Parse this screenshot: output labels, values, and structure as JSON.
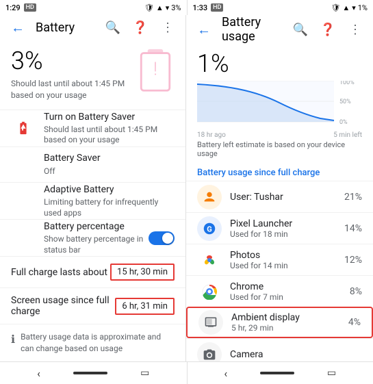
{
  "left": {
    "statusBar": {
      "time": "1:29",
      "indicator": "HD",
      "batteryPct": "3%",
      "icons": [
        "shield",
        "signal",
        "wifi",
        "battery"
      ]
    },
    "appBar": {
      "backLabel": "←",
      "title": "Battery",
      "icons": [
        "search",
        "help",
        "more"
      ]
    },
    "hero": {
      "percent": "3%",
      "desc": "Should last until about 1:45 PM based on your usage"
    },
    "items": [
      {
        "icon": "battery-alert",
        "title": "Turn on Battery Saver",
        "subtitle": "Should last until about 1:45 PM based on your usage",
        "hasIcon": true
      },
      {
        "title": "Battery Saver",
        "subtitle": "Off",
        "hasIcon": false
      },
      {
        "title": "Adaptive Battery",
        "subtitle": "Limiting battery for infrequently used apps",
        "hasIcon": false
      },
      {
        "title": "Battery percentage",
        "subtitle": "Show battery percentage in status bar",
        "hasToggle": true,
        "toggleOn": true
      }
    ],
    "chargeRows": [
      {
        "label": "Full charge lasts about",
        "value": "15 hr, 30 min",
        "highlight": false
      },
      {
        "label": "Screen usage since full charge",
        "value": "6 hr, 31 min",
        "highlight": false
      }
    ],
    "footer": "Battery usage data is approximate and can change based on usage"
  },
  "right": {
    "statusBar": {
      "time": "1:33",
      "indicator": "HD",
      "batteryPct": "1%",
      "icons": [
        "shield",
        "signal",
        "wifi",
        "battery"
      ]
    },
    "appBar": {
      "backLabel": "←",
      "title": "Battery usage",
      "icons": [
        "search",
        "help",
        "more"
      ]
    },
    "percent": "1%",
    "chart": {
      "timeStart": "18 hr ago",
      "timeEnd": "5 min left",
      "labels": [
        "100%",
        "50%",
        "0%"
      ]
    },
    "chartNote": "Battery left estimate is based on your device usage",
    "sectionHeader": "Battery usage since full charge",
    "usageItems": [
      {
        "iconType": "user",
        "iconColor": "#F57C00",
        "iconBg": "#FFF3E0",
        "title": "User: Tushar",
        "subtitle": "",
        "pct": "21%"
      },
      {
        "iconType": "pixel-launcher",
        "iconColor": "#1a73e8",
        "iconBg": "#E8F0FE",
        "title": "Pixel Launcher",
        "subtitle": "Used for 18 min",
        "pct": "14%"
      },
      {
        "iconType": "photos",
        "iconColor": "#EA4335",
        "iconBg": "#fff",
        "title": "Photos",
        "subtitle": "Used for 14 min",
        "pct": "12%"
      },
      {
        "iconType": "chrome",
        "iconColor": "#34A853",
        "iconBg": "#fff",
        "title": "Chrome",
        "subtitle": "Used for 7 min",
        "pct": "8%"
      },
      {
        "iconType": "ambient",
        "iconColor": "#5f6368",
        "iconBg": "#f5f5f5",
        "title": "Ambient display",
        "subtitle": "5 hr, 29 min",
        "pct": "4%",
        "highlight": true
      },
      {
        "iconType": "camera",
        "iconColor": "#5f6368",
        "iconBg": "#f5f5f5",
        "title": "Camera",
        "subtitle": "",
        "pct": ""
      }
    ]
  }
}
